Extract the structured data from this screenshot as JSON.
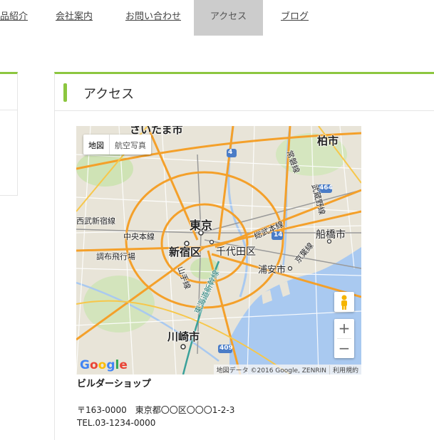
{
  "nav": {
    "items": [
      {
        "label": "品紹介",
        "active": false
      },
      {
        "label": "会社案内",
        "active": false
      },
      {
        "label": "お問い合わせ",
        "active": false
      },
      {
        "label": "アクセス",
        "active": true
      },
      {
        "label": "ブログ",
        "active": false
      }
    ]
  },
  "accent_color": "#8cc63f",
  "main": {
    "heading": "アクセス",
    "map": {
      "type_buttons": {
        "map": "地図",
        "satellite": "航空写真"
      },
      "labels": {
        "saitama": "さいたま市",
        "kashiwa": "柏市",
        "tokyo": "東京",
        "shinjuku": "新宿区",
        "chiyoda": "千代田区",
        "funabashi": "船橋市",
        "urayasu": "浦安市",
        "kawasaki": "川崎市",
        "chofu": "調布飛行場",
        "chuo_line": "中央本線",
        "seibu": "西武新宿線",
        "sobu": "総武本線",
        "yamanote": "山手線",
        "tokaido": "東海道新幹線",
        "musashino": "武蔵野線",
        "jobanline": "常磐線",
        "keiyo": "京葉線",
        "road_4": "4",
        "road_14": "14",
        "road_464": "464",
        "road_409": "409"
      },
      "zoom_in": "+",
      "zoom_out": "−",
      "google": {
        "g1": "G",
        "o1": "o",
        "o2": "o",
        "g2": "g",
        "l": "l",
        "e": "e"
      },
      "attribution": {
        "data": "地図データ ©2016 Google, ZENRIN",
        "terms": "利用規約"
      }
    },
    "shop_name": "ビルダーショップ",
    "address": "〒163-0000　東京都〇〇区〇〇〇1-2-3",
    "tel": "TEL.03-1234-0000"
  }
}
